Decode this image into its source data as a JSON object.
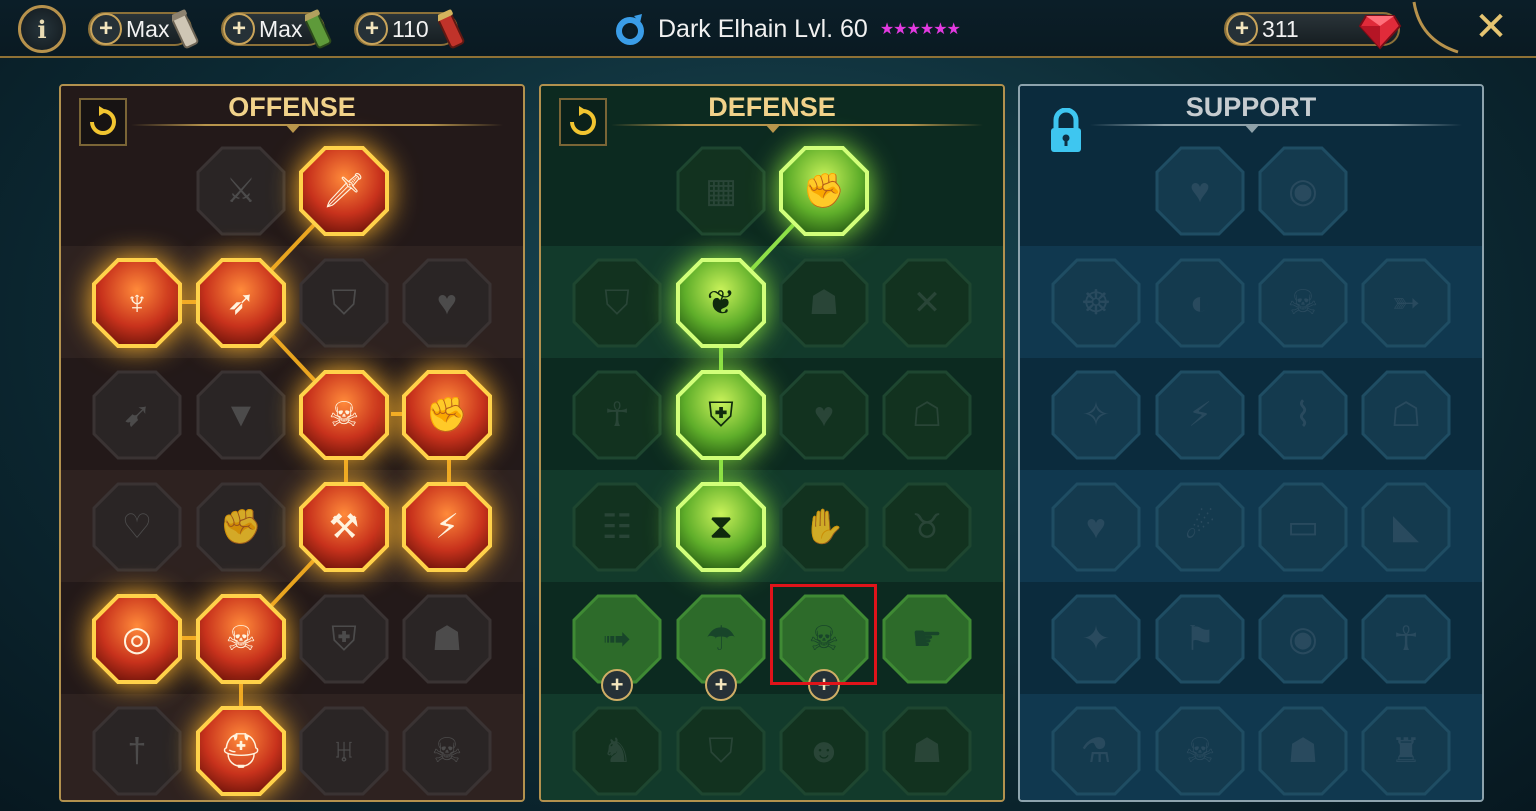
{
  "topbar": {
    "info_label": "i",
    "resources": [
      {
        "value": "Max",
        "icon": "silver-scroll-icon"
      },
      {
        "value": "Max",
        "icon": "green-scroll-icon"
      },
      {
        "value": "110",
        "icon": "red-scroll-icon"
      }
    ],
    "plus_label": "+",
    "champion_title": "Dark Elhain Lvl. 60",
    "stars": "★★★★★★",
    "gems": "311",
    "close_label": "✕",
    "colors": {
      "star": "#e23ae0",
      "gold": "#b7924c",
      "affinity": "#3a9de8"
    }
  },
  "panels": {
    "offense": {
      "title": "OFFENSE",
      "state": "reset"
    },
    "defense": {
      "title": "DEFENSE",
      "state": "reset"
    },
    "support": {
      "title": "SUPPORT",
      "state": "locked"
    }
  },
  "node_glyphs": {
    "offense": [
      [
        "crossed-swords",
        "flaming-sword",
        null,
        null
      ],
      [
        "horned-demon",
        "triple-arrow-strike",
        "cracked-shield",
        "bleeding-heart"
      ],
      [
        "archer-kneeling",
        "fanged-mouth",
        "skull-slash",
        "fist-dagger"
      ],
      [
        "heart-dagger",
        "fist-gauntlet",
        "axe-strike",
        "lightning-chains"
      ],
      [
        "bullseye-arrows",
        "three-skulls",
        "shield-sword",
        "strongman"
      ],
      [
        "dagger-stab",
        "flaming-helmet",
        "demon-lord",
        "skull-spikes"
      ]
    ],
    "defense": [
      [
        "scale-armor",
        "raised-fist",
        null,
        null
      ],
      [
        "shield-plate",
        "anatomical-heart",
        "cracked-body",
        "crossed-arrows"
      ],
      [
        "hunched-figure",
        "knight-shield",
        "shielded-heart",
        "hooded-figure"
      ],
      [
        "group-figures",
        "hourglass-rays",
        "open-hand",
        "bull-head"
      ],
      [
        "running-figure",
        "dripping-drops",
        "sun-skull",
        "grabbing-hand"
      ],
      [
        "beast-head",
        "winged-shield",
        "bald-warrior",
        "muscled-figure"
      ]
    ],
    "support": [
      [
        "healing-heart",
        "swirl-shield",
        null,
        null
      ],
      [
        "praying-hands",
        "radiant-shield",
        "smoking-skull",
        "swift-arrows"
      ],
      [
        "sparkle-figure",
        "lightning-bolt",
        "cracked-ground",
        "ghost-figures"
      ],
      [
        "heart-chains",
        "comet-strike",
        "open-book",
        "angry-eyes"
      ],
      [
        "compass-star",
        "winged-boot",
        "all-seeing-eye",
        "ninja-figure"
      ],
      [
        "potion-skull",
        "grim-skull",
        "foot-stomp",
        "eagle-head"
      ]
    ]
  }
}
